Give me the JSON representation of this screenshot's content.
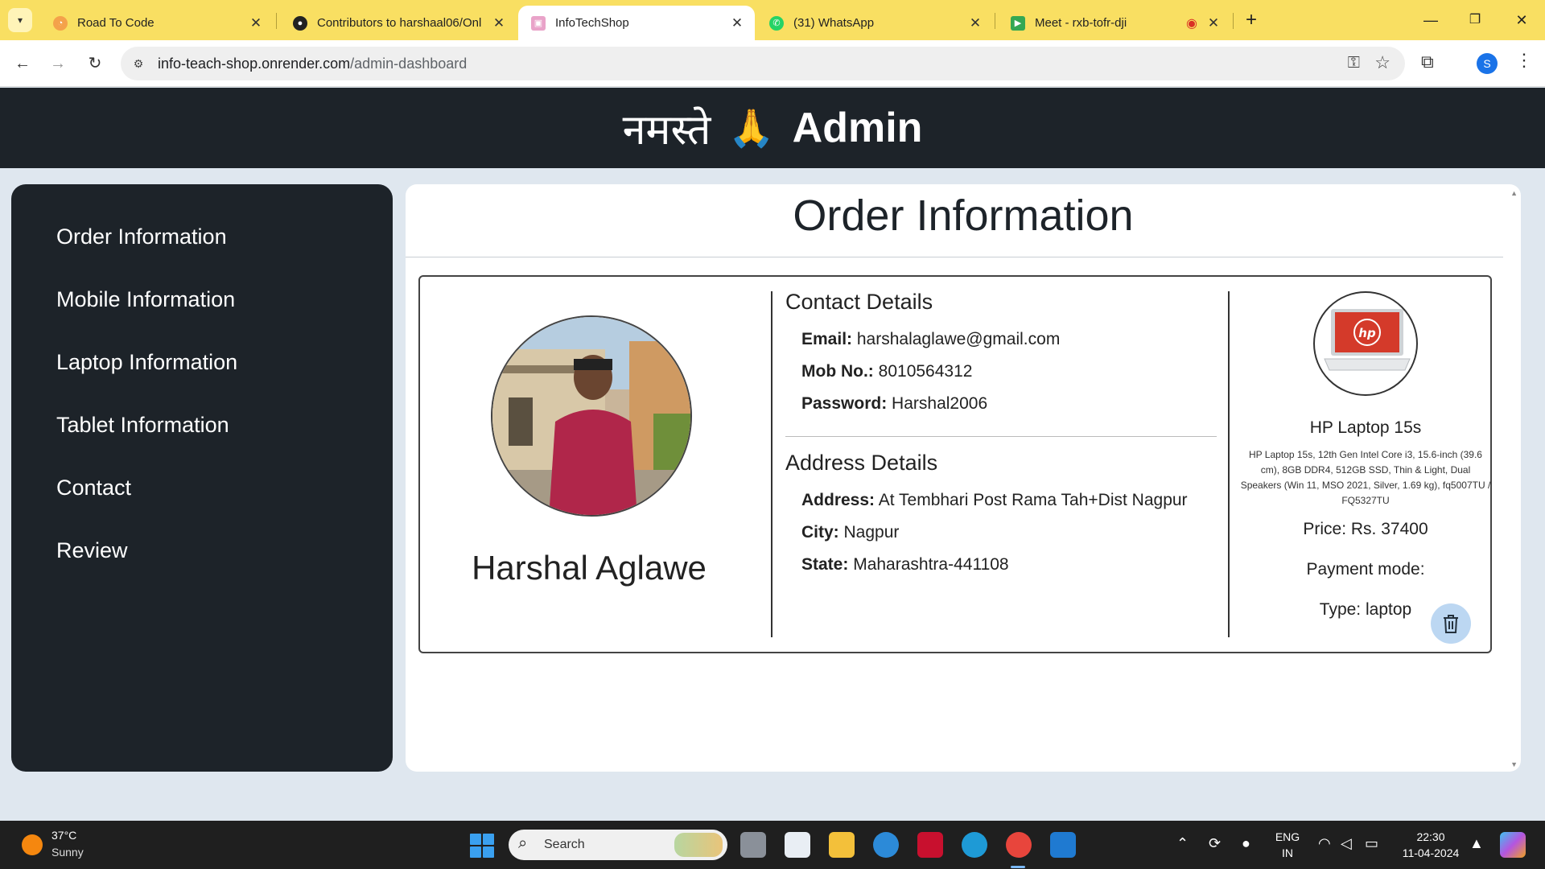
{
  "browser": {
    "tabs": [
      {
        "title": "Road To Code",
        "icon": "road-to-code-favicon",
        "active": false
      },
      {
        "title": "Contributors to harshaal06/Onl",
        "icon": "github-favicon",
        "active": false
      },
      {
        "title": "InfoTechShop",
        "icon": "infotechshop-favicon",
        "active": true
      },
      {
        "title": "(31) WhatsApp",
        "icon": "whatsapp-favicon",
        "active": false
      },
      {
        "title": "Meet - rxb-tofr-dji",
        "icon": "google-meet-favicon",
        "active": false
      }
    ],
    "url_host": "info-teach-shop.onrender.com",
    "url_path": "/admin-dashboard",
    "profile_initial": "S"
  },
  "header": {
    "greeting": "नमस्ते",
    "emoji": "🙏",
    "role": "Admin"
  },
  "sidebar": {
    "items": [
      {
        "label": "Order Information"
      },
      {
        "label": "Mobile Information"
      },
      {
        "label": "Laptop Information"
      },
      {
        "label": "Tablet Information"
      },
      {
        "label": "Contact"
      },
      {
        "label": "Review"
      }
    ]
  },
  "main": {
    "title": "Order Information",
    "order": {
      "customer_name": "Harshal Aglawe",
      "contact_title": "Contact Details",
      "email_label": "Email:",
      "email": "harshalaglawe@gmail.com",
      "mobile_label": "Mob No.:",
      "mobile": "8010564312",
      "password_label": "Password:",
      "password": "Harshal2006",
      "address_title": "Address Details",
      "address_label": "Address:",
      "address": "At Tembhari Post Rama Tah+Dist Nagpur",
      "city_label": "City:",
      "city": "Nagpur",
      "state_label": "State:",
      "state": "Maharashtra-441108",
      "product_name": "HP Laptop 15s",
      "product_desc": "HP Laptop 15s, 12th Gen Intel Core i3, 15.6-inch (39.6 cm), 8GB DDR4, 512GB SSD, Thin & Light, Dual Speakers (Win 11, MSO 2021, Silver, 1.69 kg), fq5007TU / FQ5327TU",
      "price": "Price: Rs. 37400",
      "payment_mode": "Payment mode:",
      "type": "Type: laptop",
      "product_logo_text": "hp"
    }
  },
  "taskbar": {
    "temperature": "37°C",
    "condition": "Sunny",
    "search_label": "Search",
    "lang_1": "ENG",
    "lang_2": "IN",
    "time": "22:30",
    "date": "11-04-2024"
  },
  "colors": {
    "tabbar": "#f9df62",
    "dark_panel": "#1d2329",
    "delete_button": "#bcd7f2"
  }
}
